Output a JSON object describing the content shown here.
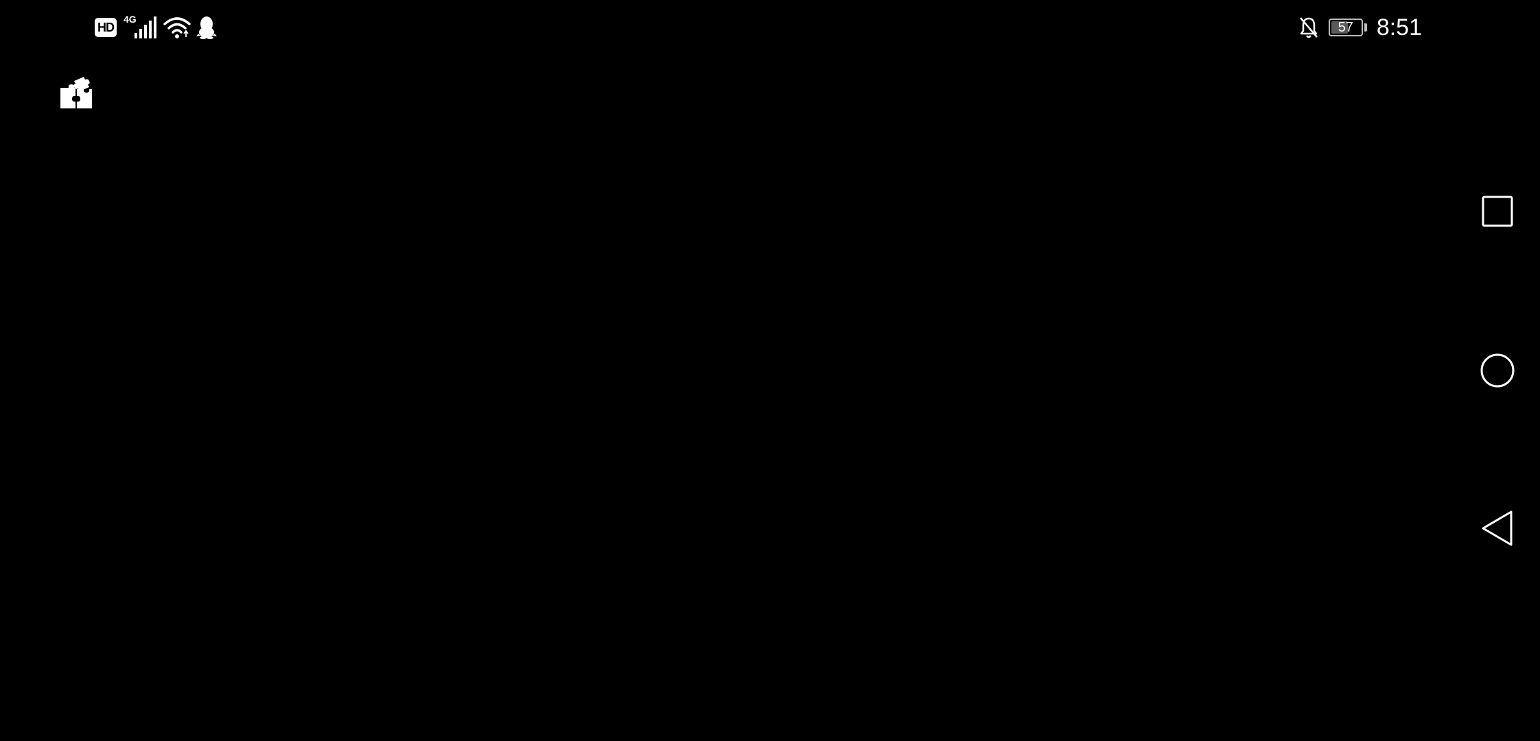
{
  "status_bar": {
    "hd_label": "HD",
    "network_type": "4G",
    "battery_level": 57,
    "battery_text": "57",
    "time": "8:51",
    "icons": [
      "signal-icon",
      "wifi-icon",
      "qq-penguin-icon",
      "bell-off-icon",
      "battery-icon"
    ]
  },
  "app": {
    "icon": "puzzle-icon"
  },
  "nav": {
    "buttons": [
      "recents-button",
      "home-button",
      "back-button"
    ]
  }
}
